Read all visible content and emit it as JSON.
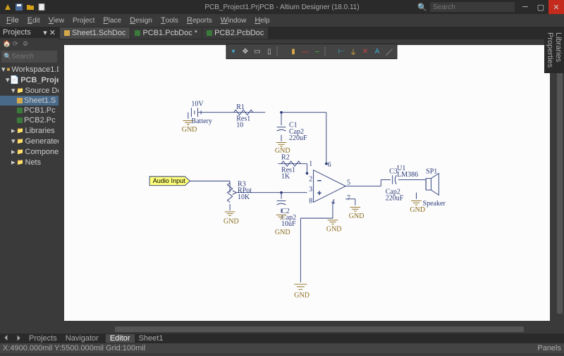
{
  "title": "PCB_Project1.PrjPCB - Altium Designer (18.0.11)",
  "search_placeholder": "Search",
  "menus": [
    "File",
    "Edit",
    "View",
    "Project",
    "Place",
    "Design",
    "Tools",
    "Reports",
    "Window",
    "Help"
  ],
  "projects_panel": {
    "title": "Projects",
    "search_placeholder": "Search",
    "tree": {
      "workspace": "Workspace1.D",
      "project": "PCB_Project",
      "source": "Source Do",
      "sheet": "Sheet1.S",
      "pcb1": "PCB1.Pc",
      "pcb2": "PCB2.Pc",
      "libraries": "Libraries",
      "generated": "Generated",
      "components": "Componer",
      "nets": "Nets"
    }
  },
  "tabs": [
    {
      "label": "Sheet1.SchDoc",
      "icon": "yellow"
    },
    {
      "label": "PCB1.PcbDoc *",
      "icon": "green"
    },
    {
      "label": "PCB2.PcbDoc",
      "icon": "green"
    }
  ],
  "right_tabs": [
    "Libraries",
    "Properties"
  ],
  "schematic": {
    "audio_input": "Audio Input",
    "battery": {
      "v": "10V",
      "name": "Battery",
      "gnd": "GND"
    },
    "r1": {
      "ref": "R1",
      "name": "Res1",
      "val": "10"
    },
    "c1": {
      "ref": "C1",
      "name": "Cap2",
      "val": "220uF",
      "gnd": "GND"
    },
    "r2": {
      "ref": "R2",
      "name": "Res1",
      "val": "1K"
    },
    "r3": {
      "ref": "R3",
      "name": "RPot",
      "val": "10K",
      "gnd": "GND"
    },
    "c2": {
      "ref": "C2",
      "name": "Cap2",
      "val": "10uF",
      "gnd": "GND"
    },
    "u1": {
      "ref": "U1",
      "name": "LM386",
      "gnd": "GND"
    },
    "c3": {
      "ref": "C3",
      "name": "Cap2",
      "val": "220uF"
    },
    "sp1": {
      "ref": "SP1",
      "name": "Speaker",
      "gnd": "GND"
    },
    "gnd_big": "GND",
    "pins": {
      "1": "1",
      "2": "2",
      "3": "3",
      "4": "4",
      "5": "5",
      "6": "6",
      "7": "7",
      "8": "8"
    }
  },
  "bottom_tabs": {
    "left": [
      "Projects",
      "Navigator"
    ],
    "right": [
      "Editor",
      "Sheet1"
    ]
  },
  "status": {
    "left": "X:4900.000mil Y:5500.000mil  Grid:100mil",
    "right": "Panels"
  }
}
